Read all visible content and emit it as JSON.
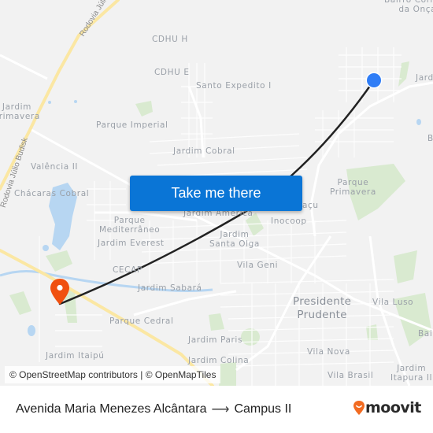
{
  "map": {
    "labels": [
      {
        "id": "cdhu-h",
        "text": "CDHU H"
      },
      {
        "id": "cdhu-e",
        "text": "CDHU E"
      },
      {
        "id": "santo-expedito",
        "text": "Santo Expedito I"
      },
      {
        "id": "bairro-corrego",
        "text": "Bairro Córrego\nda Onça"
      },
      {
        "id": "jardim-right-top",
        "text": "Jard"
      },
      {
        "id": "jardim-primavera-left",
        "text": "Jardim\nPrimavera"
      },
      {
        "id": "parque-imperial",
        "text": "Parque Imperial"
      },
      {
        "id": "jardim-cobral",
        "text": "Jardim Cobral"
      },
      {
        "id": "valencia-ii",
        "text": "Valência II"
      },
      {
        "id": "chacaras-cobral",
        "text": "Chácaras Cobral"
      },
      {
        "id": "parque-mediterraneo",
        "text": "Parque\nMediterrâneo"
      },
      {
        "id": "jardim-everest",
        "text": "Jardim Everest"
      },
      {
        "id": "jardim-america",
        "text": "Jardim América"
      },
      {
        "id": "jardim-santa-olga",
        "text": "Jardim\nSanta Olga"
      },
      {
        "id": "inocoop",
        "text": "Inocoop"
      },
      {
        "id": "acu",
        "text": "açu"
      },
      {
        "id": "parque-primavera",
        "text": "Parque\nPrimavera"
      },
      {
        "id": "cecap",
        "text": "CECAP"
      },
      {
        "id": "vila-geni",
        "text": "Vila Geni"
      },
      {
        "id": "jardim-sabara",
        "text": "Jardim Sabará"
      },
      {
        "id": "presidente-prudente",
        "text": "Presidente\nPrudente"
      },
      {
        "id": "vila-luso",
        "text": "Vila Luso"
      },
      {
        "id": "parque-cedral",
        "text": "Parque Cedral"
      },
      {
        "id": "jardim-paris",
        "text": "Jardim Paris"
      },
      {
        "id": "jardim-colina",
        "text": "Jardim Colina"
      },
      {
        "id": "vila-nova",
        "text": "Vila Nova"
      },
      {
        "id": "jardim-itaipu",
        "text": "Jardim Itaipú"
      },
      {
        "id": "vila-brasil",
        "text": "Vila Brasil"
      },
      {
        "id": "jardim-itapura",
        "text": "Jardim\nItapura II"
      },
      {
        "id": "bairro-right",
        "text": "Bair"
      },
      {
        "id": "b-right",
        "text": "B"
      }
    ],
    "road_labels": {
      "rodovia_top": "Rodovia Júlio",
      "rodovia_left": "Rodovia Júlio Budisk"
    },
    "origin_marker_color": "#2f7df6",
    "destination_marker_color": "#f0500f",
    "route_color": "#222222",
    "cta_label": "Take me there",
    "attribution": "© OpenStreetMap contributors | © OpenMapTiles"
  },
  "footer": {
    "origin": "Avenida Maria Menezes Alcântara",
    "arrow": "⟶",
    "destination": "Campus II",
    "brand": "moovit",
    "brand_color": "#f26b21"
  }
}
